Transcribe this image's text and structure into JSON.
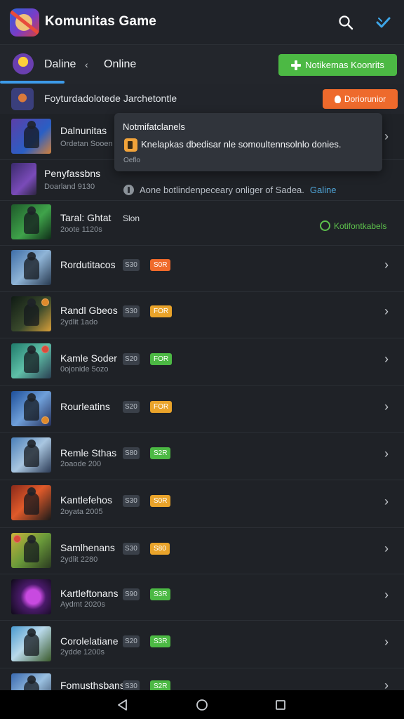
{
  "appbar": {
    "title": "Komunitas Game",
    "icons": [
      "app-logo",
      "search-icon",
      "check-icon"
    ]
  },
  "filter": {
    "tabs": [
      "Daline",
      "Online"
    ],
    "create_button": "Notikemas Koonrits"
  },
  "highlight_row": {
    "text": "Foyturdadolotede Jarchetontle",
    "report_button": "Doriorunior"
  },
  "tooltip": {
    "title": "Notmifatclanels",
    "body": "Knelapkas dbedisar nle somoultennsolnlo donies.",
    "footer": "Oeflo"
  },
  "info": {
    "text": "Aone botlindenpeceary onliger of Sadea.",
    "link": "Galine"
  },
  "status": {
    "label": "Kotifontkabels",
    "color": "#5dc24c"
  },
  "games": [
    {
      "name": "Dalnunitas",
      "sub": "Ordetan Sooen"
    },
    {
      "name": "Penyfassbns",
      "sub": "Doarland 9130"
    },
    {
      "name": "Taral: Ghtat",
      "sub": "2oote 1120s",
      "tag": "Slon"
    },
    {
      "name": "Rordutitacos",
      "sub": "",
      "tag": "S30",
      "badge": "S0R",
      "badge_color": "#ef6a2b"
    },
    {
      "name": "Randl Gbeos",
      "sub": "2ydlit 1ado",
      "tag": "S30",
      "badge": "FOR",
      "badge_color": "#e9a32a"
    },
    {
      "name": "Kamle Soder",
      "sub": "0ojonide 5ozo",
      "tag": "S20",
      "badge": "FOR",
      "badge_color": "#4cb944"
    },
    {
      "name": "Rourleatins",
      "sub": "",
      "tag": "S20",
      "badge": "FOR",
      "badge_color": "#e9a32a"
    },
    {
      "name": "Remle Sthas",
      "sub": "2oaode 200",
      "tag": "S80",
      "badge": "S2R",
      "badge_color": "#4cb944"
    },
    {
      "name": "Kantlefehos",
      "sub": "2oyata 2005",
      "tag": "S30",
      "badge": "S0R",
      "badge_color": "#e9a32a"
    },
    {
      "name": "Samlhenans",
      "sub": "2ydlit 2280",
      "tag": "S30",
      "badge": "S80",
      "badge_color": "#e9a32a"
    },
    {
      "name": "Kartleftonans",
      "sub": "Aydmt 2020s",
      "tag": "S90",
      "badge": "S3R",
      "badge_color": "#4cb944"
    },
    {
      "name": "Corolelatiane",
      "sub": "2ydde 1200s",
      "tag": "S20",
      "badge": "S3R",
      "badge_color": "#4cb944"
    },
    {
      "name": "Fomusthsbans",
      "sub": "",
      "tag": "S30",
      "badge": "S2R",
      "badge_color": "#4cb944"
    }
  ],
  "navbar": {
    "icons": [
      "back-icon",
      "home-icon",
      "recents-icon"
    ]
  }
}
